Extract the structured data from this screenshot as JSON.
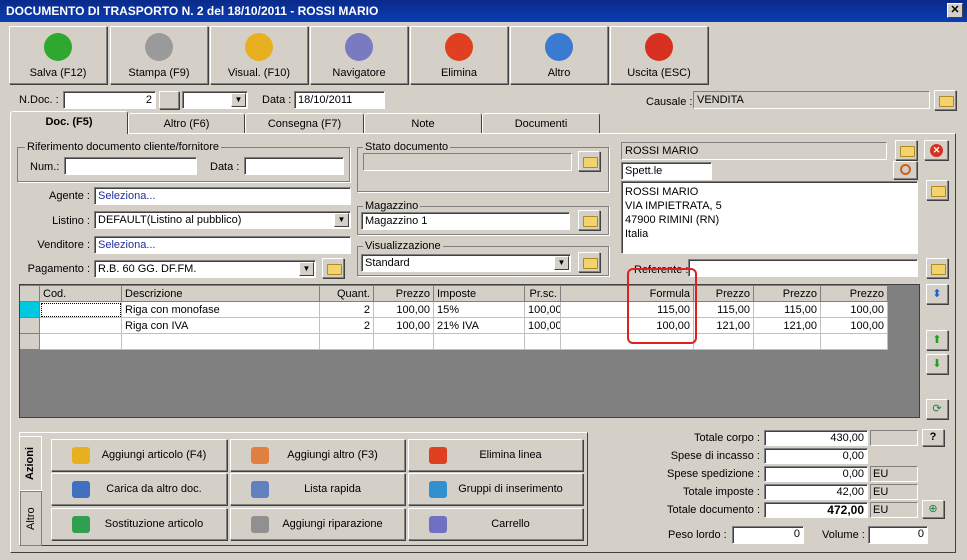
{
  "window": {
    "title": "DOCUMENTO DI TRASPORTO N. 2  del 18/10/2011 - ROSSI MARIO",
    "close": "✕"
  },
  "toolbar": [
    {
      "label": "Salva (F12)",
      "icon": "check-icon",
      "color": "#2fa82f"
    },
    {
      "label": "Stampa (F9)",
      "icon": "printer-icon",
      "color": "#9a9a9a"
    },
    {
      "label": "Visual. (F10)",
      "icon": "magic-wand-icon",
      "color": "#e8b020"
    },
    {
      "label": "Navigatore",
      "icon": "compass-icon",
      "color": "#7a7ac0"
    },
    {
      "label": "Elimina",
      "icon": "delete-x-icon",
      "color": "#e04020"
    },
    {
      "label": "Altro",
      "icon": "magnifier-icon",
      "color": "#3a7ad0"
    },
    {
      "label": "Uscita (ESC)",
      "icon": "exit-icon",
      "color": "#d83020"
    }
  ],
  "header": {
    "ndoc_label": "N.Doc. :",
    "ndoc_value": "2",
    "data_label": "Data :",
    "data_value": "18/10/2011",
    "causale_label": "Causale :",
    "causale_value": "VENDITA"
  },
  "tabs": [
    "Doc. (F5)",
    "Altro (F6)",
    "Consegna (F7)",
    "Note",
    "Documenti"
  ],
  "rif": {
    "group": "Riferimento documento cliente/fornitore",
    "num": "Num.:",
    "data": "Data :"
  },
  "form": {
    "agente_label": "Agente :",
    "agente_value": "Seleziona...",
    "listino_label": "Listino :",
    "listino_value": "DEFAULT(Listino al pubblico)",
    "venditore_label": "Venditore :",
    "venditore_value": "Seleziona...",
    "pagamento_label": "Pagamento :",
    "pagamento_value": "R.B. 60 GG. DF.FM."
  },
  "stato": {
    "group": "Stato documento",
    "value": ""
  },
  "magazzino": {
    "group": "Magazzino",
    "value": "Magazzino 1"
  },
  "visualizzazione": {
    "group": "Visualizzazione",
    "value": "Standard"
  },
  "cliente": {
    "name": "ROSSI MARIO",
    "title": "Spett.le",
    "address": [
      "ROSSI MARIO",
      "VIA IMPIETRATA, 5",
      "47900 RIMINI (RN)",
      "Italia"
    ],
    "referente_label": "Referente :"
  },
  "grid": {
    "headers": [
      "Cod.",
      "Descrizione",
      "Quant.",
      "Prezzo",
      "Imposte",
      "Pr.sc.",
      "Formula",
      "Prezzo",
      "Prezzo",
      "Prezzo"
    ],
    "rows": [
      [
        "",
        "Riga con monofase",
        "2",
        "100,00",
        "15%",
        "100,00",
        "115,00",
        "115,00",
        "115,00",
        "100,00"
      ],
      [
        "",
        "Riga con IVA",
        "2",
        "100,00",
        "21% IVA",
        "100,00",
        "100,00",
        "121,00",
        "121,00",
        "100,00"
      ]
    ]
  },
  "actions": {
    "side_tabs": [
      "Azioni",
      "Altro"
    ],
    "buttons": [
      {
        "label": "Aggiungi articolo (F4)",
        "icon": "add-article-icon"
      },
      {
        "label": "Aggiungi altro (F3)",
        "icon": "add-other-icon"
      },
      {
        "label": "Elimina linea",
        "icon": "delete-line-icon"
      },
      {
        "label": "Carica da altro doc.",
        "icon": "load-document-icon"
      },
      {
        "label": "Lista rapida",
        "icon": "quick-list-icon"
      },
      {
        "label": "Gruppi di inserimento",
        "icon": "insert-groups-icon"
      },
      {
        "label": "Sostituzione articolo",
        "icon": "replace-article-icon"
      },
      {
        "label": "Aggiungi riparazione",
        "icon": "wrench-icon"
      },
      {
        "label": "Carrello",
        "icon": "cart-icon"
      }
    ]
  },
  "totals": {
    "corpo_label": "Totale corpo :",
    "corpo_value": "430,00",
    "incasso_label": "Spese di incasso :",
    "incasso_value": "0,00",
    "spedizione_label": "Spese spedizione :",
    "spedizione_value": "0,00",
    "spedizione_unit": "EU",
    "imposte_label": "Totale imposte :",
    "imposte_value": "42,00",
    "imposte_unit": "EU",
    "documento_label": "Totale documento :",
    "documento_value": "472,00",
    "documento_unit": "EU",
    "peso_label": "Peso lordo :",
    "peso_value": "0",
    "volume_label": "Volume :",
    "volume_value": "0",
    "help": "?"
  }
}
